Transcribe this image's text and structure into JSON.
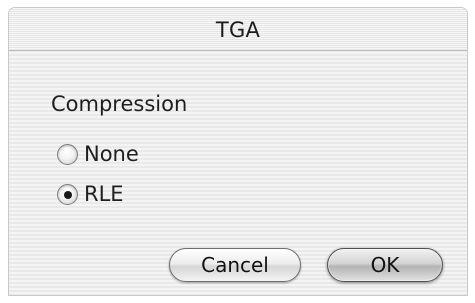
{
  "window": {
    "title": "TGA"
  },
  "compression": {
    "label": "Compression",
    "options": [
      {
        "label": "None",
        "selected": false
      },
      {
        "label": "RLE",
        "selected": true
      }
    ]
  },
  "buttons": {
    "cancel_label": "Cancel",
    "ok_label": "OK"
  }
}
